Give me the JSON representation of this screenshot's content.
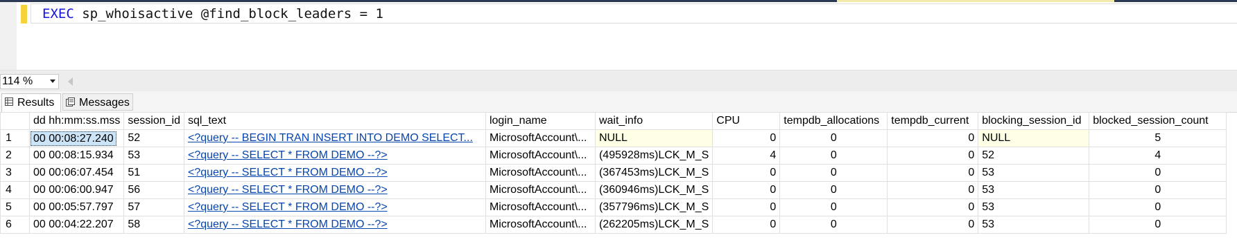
{
  "editor": {
    "code_keyword": "EXEC",
    "code_rest": " sp_whoisactive @find_block_leaders = 1"
  },
  "zoom": {
    "value": "114 %"
  },
  "tabs": [
    {
      "label": "Results"
    },
    {
      "label": "Messages"
    }
  ],
  "grid": {
    "columns": [
      "dd hh:mm:ss.mss",
      "session_id",
      "sql_text",
      "login_name",
      "wait_info",
      "CPU",
      "tempdb_allocations",
      "tempdb_current",
      "blocking_session_id",
      "blocked_session_count"
    ],
    "rows": [
      {
        "row": "1",
        "dd": "00 00:08:27.240",
        "session_id": "52",
        "sql_text": "<?query --  BEGIN TRAN  INSERT INTO DEMO  SELECT...",
        "login_name": "MicrosoftAccount\\...",
        "wait_info": "NULL",
        "cpu": "0",
        "tempdb_allocations": "0",
        "tempdb_current": "0",
        "blocking_session_id": "NULL",
        "blocked_session_count": "5"
      },
      {
        "row": "2",
        "dd": "00 00:08:15.934",
        "session_id": "53",
        "sql_text": "<?query --  SELECT * FROM DEMO  --?>",
        "login_name": "MicrosoftAccount\\...",
        "wait_info": "(495928ms)LCK_M_S",
        "cpu": "4",
        "tempdb_allocations": "0",
        "tempdb_current": "0",
        "blocking_session_id": "52",
        "blocked_session_count": "4"
      },
      {
        "row": "3",
        "dd": "00 00:06:07.454",
        "session_id": "51",
        "sql_text": "<?query --  SELECT * FROM DEMO  --?>",
        "login_name": "MicrosoftAccount\\...",
        "wait_info": "(367453ms)LCK_M_S",
        "cpu": "0",
        "tempdb_allocations": "0",
        "tempdb_current": "0",
        "blocking_session_id": "53",
        "blocked_session_count": "0"
      },
      {
        "row": "4",
        "dd": "00 00:06:00.947",
        "session_id": "56",
        "sql_text": "<?query --  SELECT * FROM DEMO  --?>",
        "login_name": "MicrosoftAccount\\...",
        "wait_info": "(360946ms)LCK_M_S",
        "cpu": "0",
        "tempdb_allocations": "0",
        "tempdb_current": "0",
        "blocking_session_id": "53",
        "blocked_session_count": "0"
      },
      {
        "row": "5",
        "dd": "00 00:05:57.797",
        "session_id": "57",
        "sql_text": "<?query --  SELECT * FROM DEMO  --?>",
        "login_name": "MicrosoftAccount\\...",
        "wait_info": "(357796ms)LCK_M_S",
        "cpu": "0",
        "tempdb_allocations": "0",
        "tempdb_current": "0",
        "blocking_session_id": "53",
        "blocked_session_count": "0"
      },
      {
        "row": "6",
        "dd": "00 00:04:22.207",
        "session_id": "58",
        "sql_text": "<?query --  SELECT * FROM DEMO  --?>",
        "login_name": "MicrosoftAccount\\...",
        "wait_info": "(262205ms)LCK_M_S",
        "cpu": "0",
        "tempdb_allocations": "0",
        "tempdb_current": "0",
        "blocking_session_id": "53",
        "blocked_session_count": "0"
      }
    ]
  },
  "colors": {
    "keyword": "#1414e0",
    "link": "#0645ad",
    "null_bg": "#ffffe6",
    "change_marker": "#f5d33b"
  }
}
